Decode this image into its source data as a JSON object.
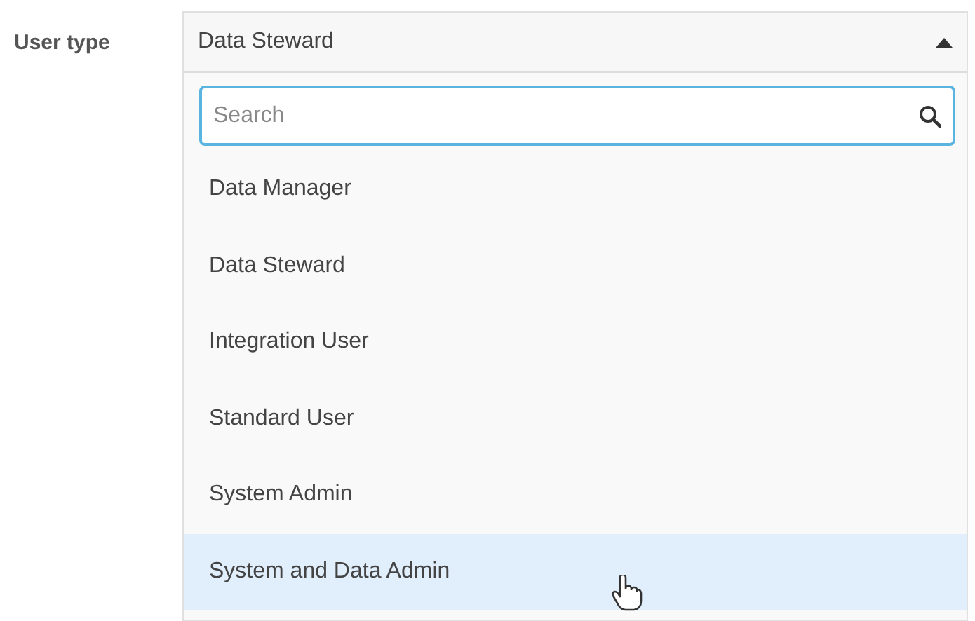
{
  "field": {
    "label": "User type",
    "value": "Data Steward",
    "expanded": true
  },
  "search": {
    "placeholder": "Search"
  },
  "options": [
    {
      "label": "Data Manager",
      "highlighted": false
    },
    {
      "label": "Data Steward",
      "highlighted": false
    },
    {
      "label": "Integration User",
      "highlighted": false
    },
    {
      "label": "Standard User",
      "highlighted": false
    },
    {
      "label": "System Admin",
      "highlighted": false
    },
    {
      "label": "System and Data Admin",
      "highlighted": true
    }
  ]
}
